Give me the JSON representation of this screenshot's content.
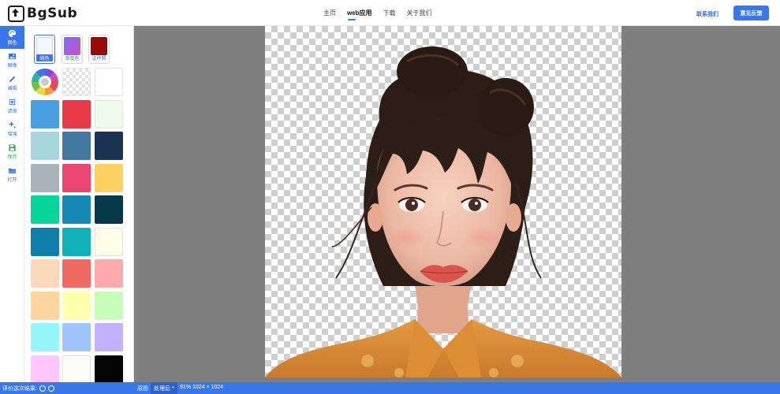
{
  "header": {
    "logo_text": "BgSub",
    "nav": [
      "主页",
      "web应用",
      "下载",
      "关于我们"
    ],
    "active_nav": "web应用",
    "contact": "联系我们",
    "feedback": "意见反馈"
  },
  "toolbar": [
    {
      "label": "颜色",
      "icon": "palette-icon",
      "active": true
    },
    {
      "label": "图像",
      "icon": "image-icon"
    },
    {
      "label": "编辑",
      "icon": "pencil-icon"
    },
    {
      "label": "滤镜",
      "icon": "filter-icon"
    },
    {
      "label": "增强",
      "icon": "sparkle-icon"
    },
    {
      "label": "保存",
      "icon": "save-icon"
    },
    {
      "label": "打开",
      "icon": "folder-icon"
    }
  ],
  "color_panel": {
    "types": [
      {
        "label": "纯色",
        "color": "#f4f7fc",
        "active": true
      },
      {
        "label": "渐变色",
        "color": "#b25ad8"
      },
      {
        "label": "证件照",
        "color": "#9b0808"
      }
    ],
    "swatches": [
      "color-wheel",
      "transparent",
      "#ffffff",
      "#4a9fe0",
      "#e83a49",
      "#eefaea",
      "#a7d7dc",
      "#4278a0",
      "#1c3252",
      "#a9b2ba",
      "#ea4672",
      "#fdd262",
      "#08d59c",
      "#1688b4",
      "#073848",
      "#0e7fa8",
      "#10b1b8",
      "#fffde6",
      "#fdd9bc",
      "#ee6a63",
      "#fea9ab",
      "#ffd49e",
      "#ffffad",
      "#c6fdb8",
      "#96f7fb",
      "#a1c4fd",
      "#c0b2fc",
      "#ffc6fe",
      "#fdfdf8",
      "#050505"
    ]
  },
  "status_bar": {
    "rating": "评价这次结果:",
    "original": "原图",
    "processed": "处理后 *",
    "info": "91% 1024 × 1024"
  }
}
